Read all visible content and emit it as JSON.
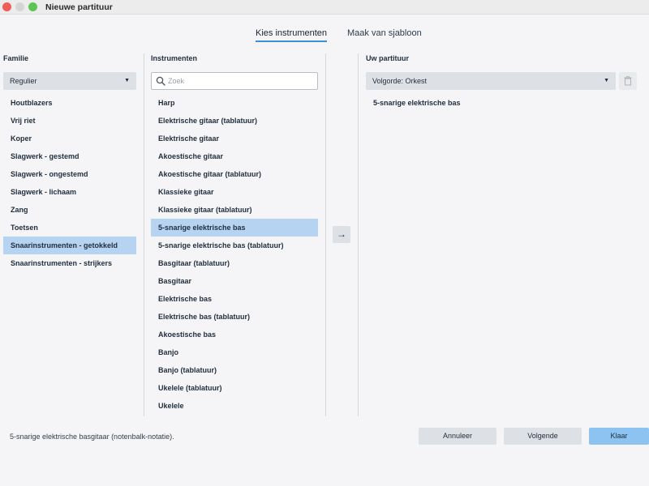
{
  "window": {
    "title": "Nieuwe partituur"
  },
  "tabs": [
    {
      "label": "Kies instrumenten",
      "active": true
    },
    {
      "label": "Maak van sjabloon",
      "active": false
    }
  ],
  "family": {
    "header": "Familie",
    "dropdown": "Regulier",
    "items": [
      "Houtblazers",
      "Vrij riet",
      "Koper",
      "Slagwerk - gestemd",
      "Slagwerk - ongestemd",
      "Slagwerk - lichaam",
      "Zang",
      "Toetsen",
      "Snaarinstrumenten - getokkeld",
      "Snaarinstrumenten - strijkers"
    ],
    "selected_index": 8
  },
  "instruments": {
    "header": "Instrumenten",
    "search_placeholder": "Zoek",
    "search_value": "",
    "items": [
      "Harp",
      "Elektrische gitaar (tablatuur)",
      "Elektrische gitaar",
      "Akoestische gitaar",
      "Akoestische gitaar (tablatuur)",
      "Klassieke gitaar",
      "Klassieke gitaar (tablatuur)",
      "5-snarige elektrische bas",
      "5-snarige elektrische bas (tablatuur)",
      "Basgitaar (tablatuur)",
      "Basgitaar",
      "Elektrische bas",
      "Elektrische bas (tablatuur)",
      "Akoestische bas",
      "Banjo",
      "Banjo (tablatuur)",
      "Ukelele (tablatuur)",
      "Ukelele"
    ],
    "selected_index": 7
  },
  "score": {
    "header": "Uw partituur",
    "order_dropdown": "Volgorde: Orkest",
    "items": [
      "5-snarige elektrische bas"
    ]
  },
  "icons": {
    "add": "arrow-right-icon",
    "delete": "trash-icon",
    "search": "search-icon"
  },
  "status_text": "5-snarige elektrische basgitaar (notenbalk-notatie).",
  "buttons": {
    "cancel": "Annuleer",
    "next": "Volgende",
    "done": "Klaar"
  },
  "colors": {
    "selection": "#b6d4f1",
    "accent": "#3c8fd8",
    "primary_button": "#8cc3f0",
    "close": "#ee5f57",
    "maximize": "#5ec552"
  }
}
